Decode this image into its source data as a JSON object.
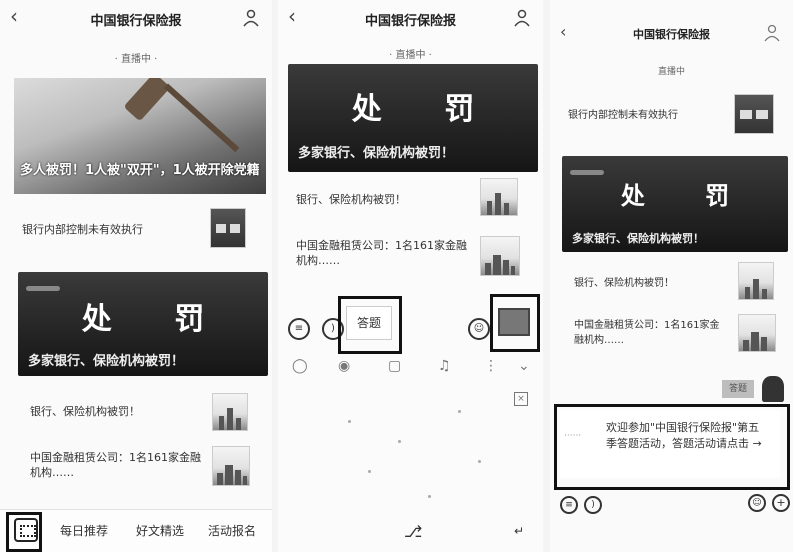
{
  "panel1": {
    "title": "中国银行保险报",
    "status": "· 直播中 ·",
    "hero_caption": "多人被罚！1人被\"双开\"，1人被开除党籍",
    "article1": "银行内部控制未有效执行",
    "banner_big": "处 罚",
    "banner_sub": "多家银行、保险机构被罚！",
    "article2": "银行、保险机构被罚！",
    "article3": "中国金融租赁公司：1名161家金融机构……",
    "tabs": [
      "每日推荐",
      "好文精选",
      "活动报名"
    ]
  },
  "panel2": {
    "title": "中国银行保险报",
    "status": "· 直播中 ·",
    "banner_big": "处 罚",
    "banner_sub": "多家银行、保险机构被罚！",
    "article1": "银行、保险机构被罚！",
    "article2": "中国金融租赁公司：1名161家金融机构……",
    "input_text": "答题"
  },
  "panel3": {
    "title": "中国银行保险报",
    "status": "直播中",
    "article0": "银行内部控制未有效执行",
    "banner_big": "处 罚",
    "banner_sub": "多家银行、保险机构被罚！",
    "article1": "银行、保险机构被罚！",
    "article2": "中国金融租赁公司：1名161家金融机构……",
    "msg_label": "答题",
    "bubble_text": "欢迎参加\"中国银行保险报\"第五季答题活动，答题活动请点击 →"
  }
}
